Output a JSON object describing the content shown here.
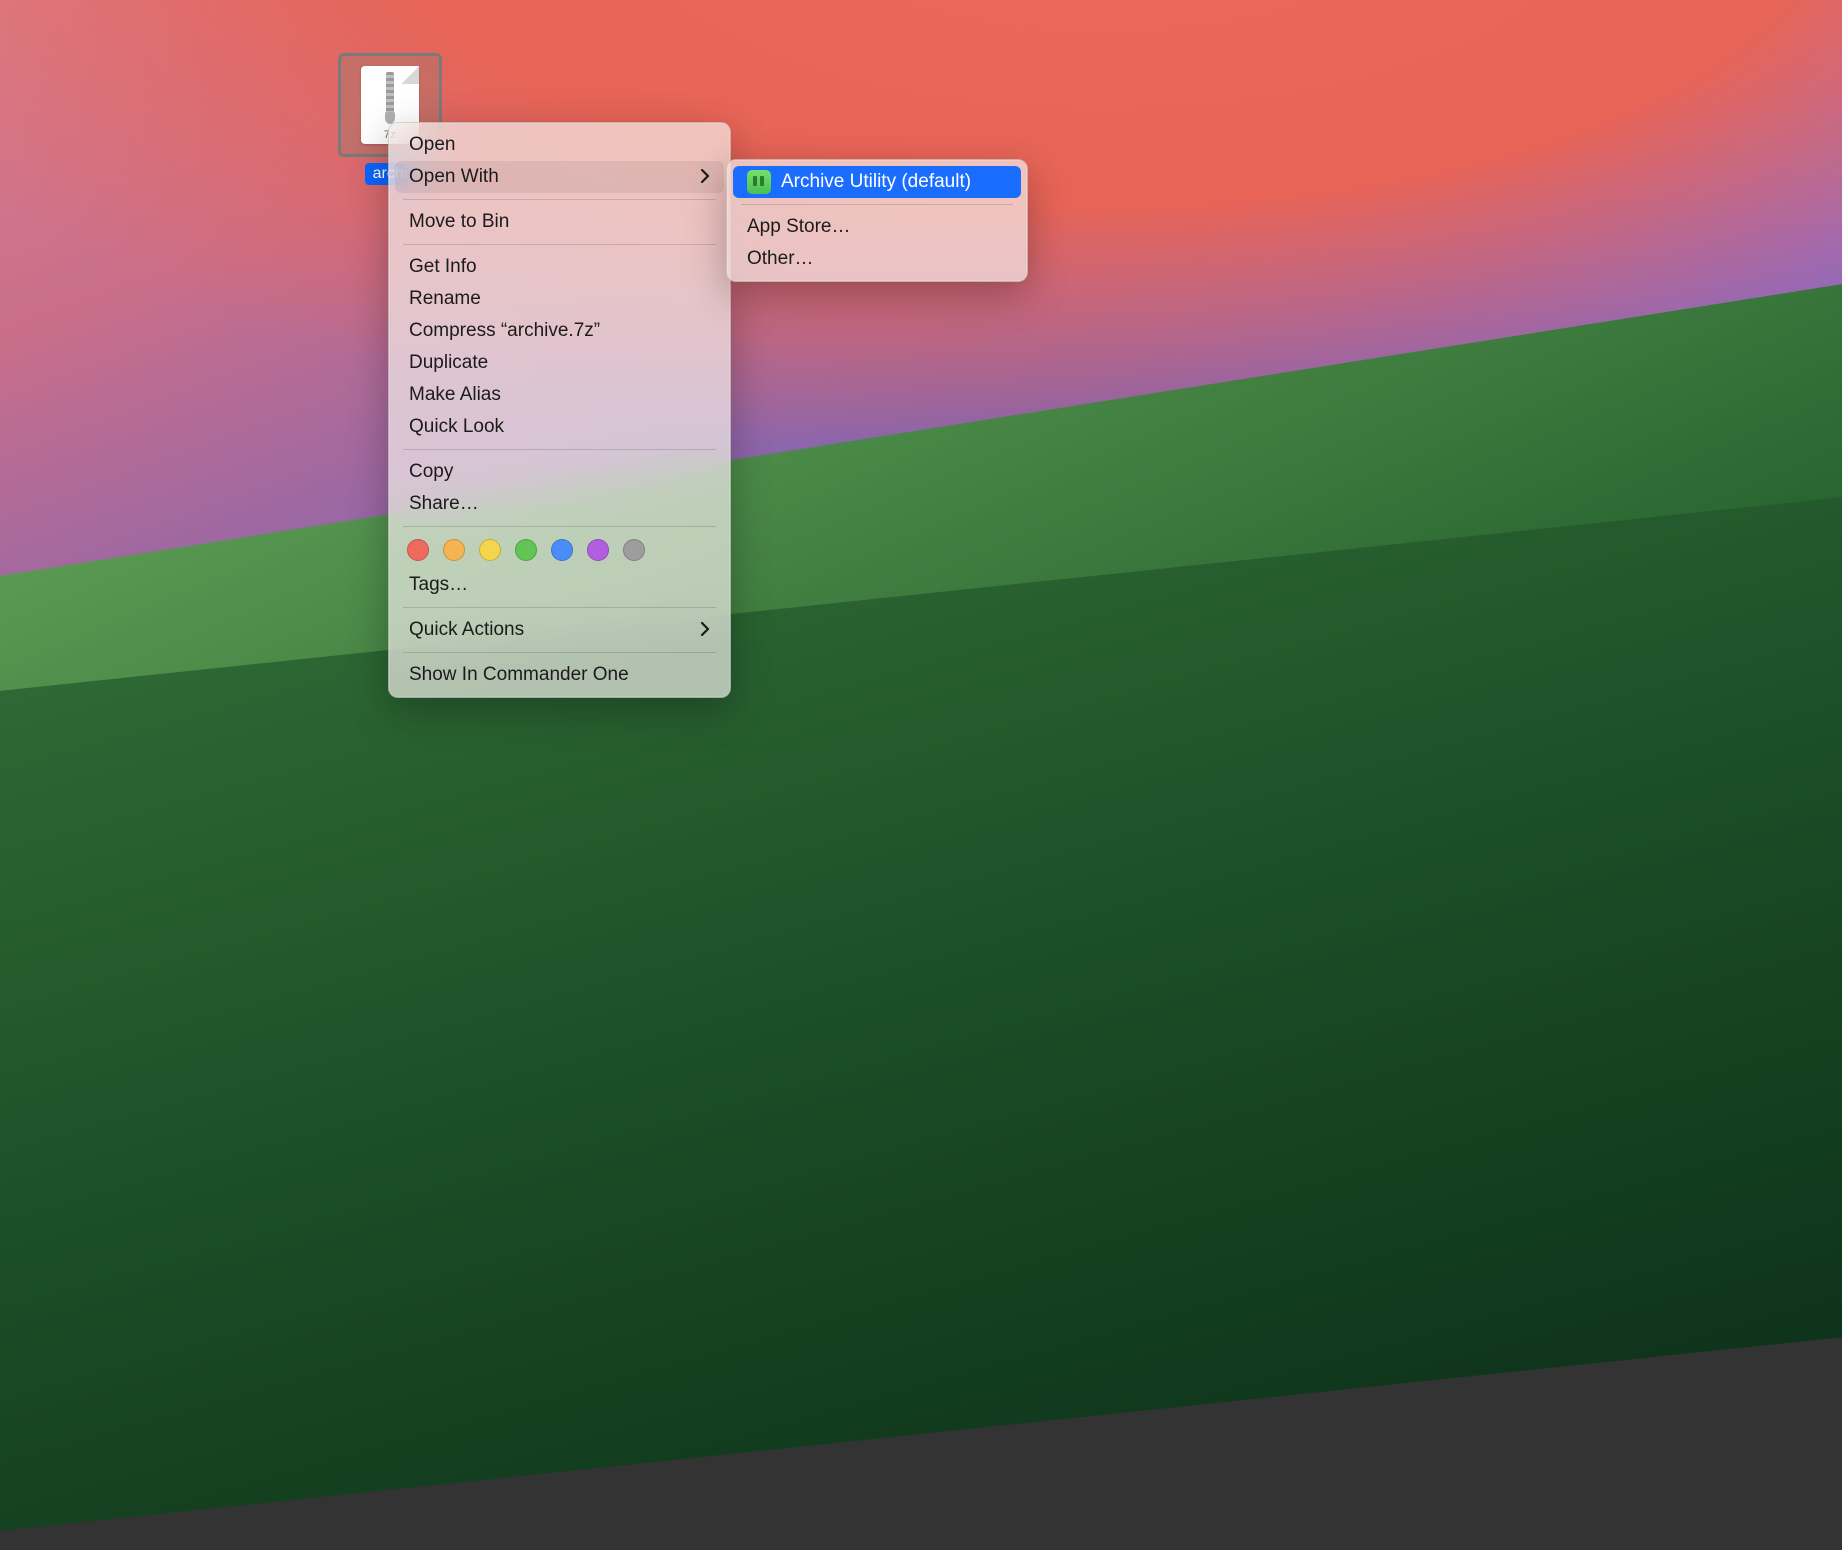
{
  "file": {
    "name": "archive.7z",
    "label_visible": "archi",
    "ext_badge": "7z"
  },
  "context_menu": {
    "open": "Open",
    "open_with": "Open With",
    "move_to_bin": "Move to Bin",
    "get_info": "Get Info",
    "rename": "Rename",
    "compress": "Compress “archive.7z”",
    "duplicate": "Duplicate",
    "make_alias": "Make Alias",
    "quick_look": "Quick Look",
    "copy": "Copy",
    "share": "Share…",
    "tags": "Tags…",
    "quick_actions": "Quick Actions",
    "show_in_commander": "Show In Commander One"
  },
  "open_with_menu": {
    "archive_utility": "Archive Utility (default)",
    "app_store": "App Store…",
    "other": "Other…"
  },
  "tag_colors": [
    "#ec6a5e",
    "#f4b450",
    "#f5d54b",
    "#61c454",
    "#4b8df8",
    "#b15fe0",
    "#9d9d9d"
  ]
}
